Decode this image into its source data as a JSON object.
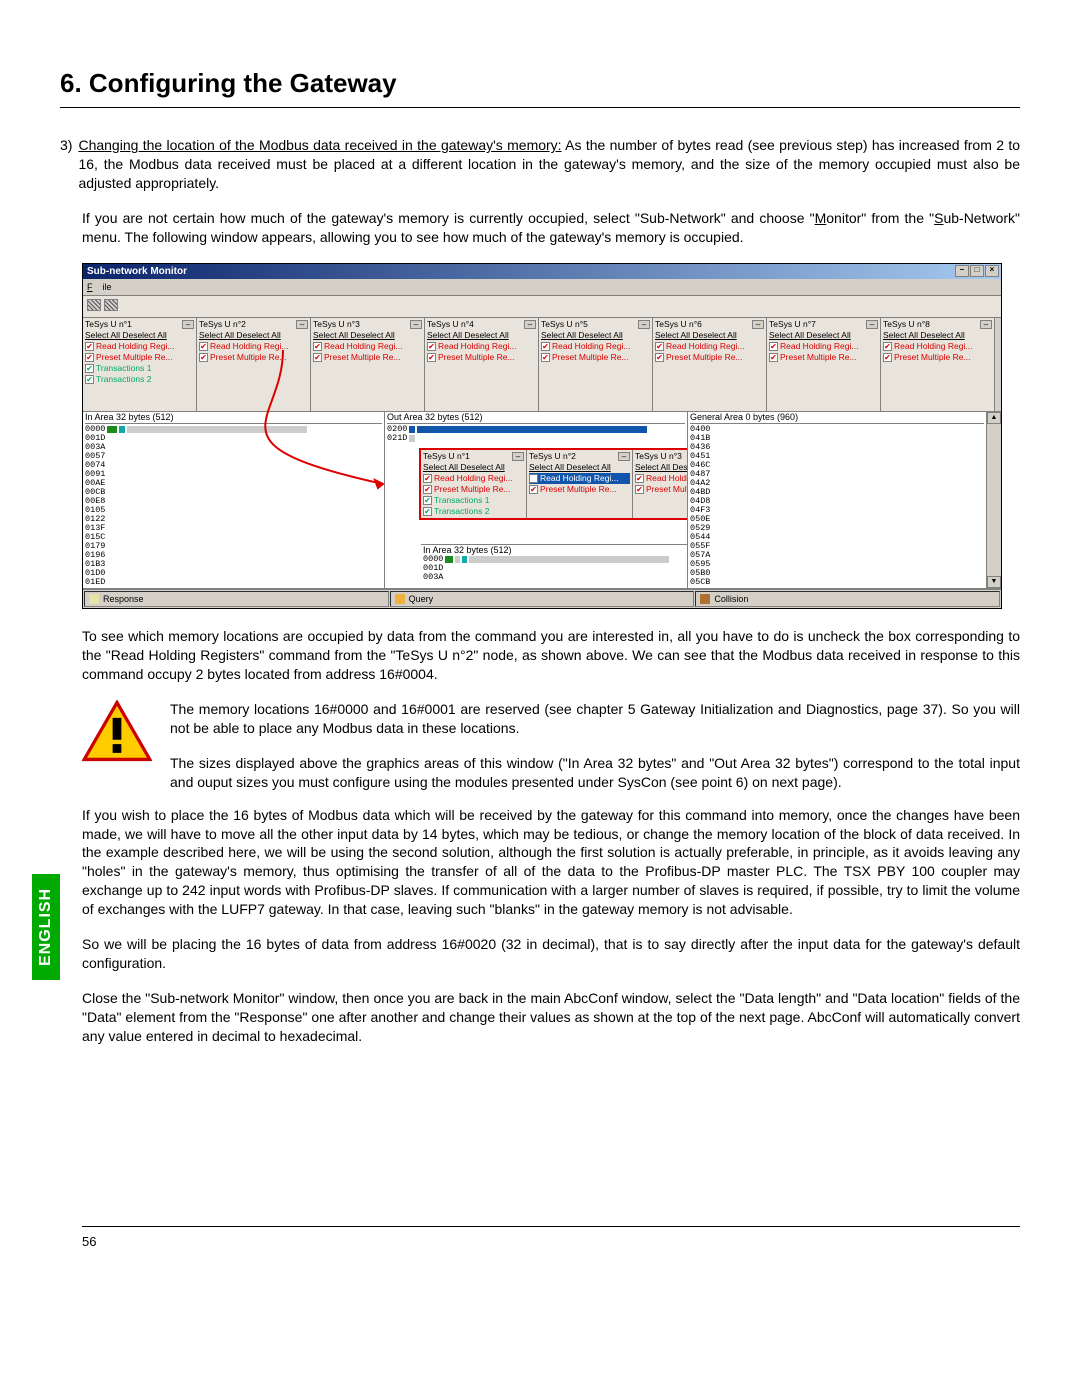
{
  "section_title": "6. Configuring the Gateway",
  "english_badge": "ENGLISH",
  "page_number": "56",
  "item3": {
    "num": "3)",
    "lead_underline": "Changing the location of the Modbus data received in the gateway's memory:",
    "lead_rest": " As the number of bytes read (see previous step) has increased from 2 to 16, the Modbus data received must be placed at a different location in the gateway's memory, and the size of the memory occupied must also be adjusted appropriately."
  },
  "para_if": {
    "p1": "If you are not certain how much of the gateway's memory is currently occupied, select \"Sub-Network\" and choose \"",
    "m": "M",
    "p2": "onitor\" from the \"",
    "s": "S",
    "p3": "ub-Network\" menu. The following window appears, allowing you to see how much of the gateway's memory is occupied."
  },
  "win": {
    "title": "Sub-network Monitor",
    "file": "File",
    "nodes": [
      {
        "name": "TeSys U n°1",
        "select": "Select All  Deselect All",
        "rhr": "Read Holding Regi...",
        "pmr": "Preset Multiple Re...",
        "t1": "Transactions 1",
        "t2": "Transactions 2"
      },
      {
        "name": "TeSys U n°2",
        "select": "Select All  Deselect All",
        "rhr": "Read Holding Regi...",
        "pmr": "Preset Multiple Re..."
      },
      {
        "name": "TeSys U n°3",
        "select": "Select All  Deselect All",
        "rhr": "Read Holding Regi...",
        "pmr": "Preset Multiple Re..."
      },
      {
        "name": "TeSys U n°4",
        "select": "Select All  Deselect All",
        "rhr": "Read Holding Regi...",
        "pmr": "Preset Multiple Re..."
      },
      {
        "name": "TeSys U n°5",
        "select": "Select All  Deselect All",
        "rhr": "Read Holding Regi...",
        "pmr": "Preset Multiple Re..."
      },
      {
        "name": "TeSys U n°6",
        "select": "Select All  Deselect All",
        "rhr": "Read Holding Regi...",
        "pmr": "Preset Multiple Re..."
      },
      {
        "name": "TeSys U n°7",
        "select": "Select All  Deselect All",
        "rhr": "Read Holding Regi...",
        "pmr": "Preset Multiple Re..."
      },
      {
        "name": "TeSys U n°8",
        "select": "Select All  Deselect All",
        "rhr": "Read Holding Regi...",
        "pmr": "Preset Multiple Re..."
      }
    ],
    "areas": {
      "in_hdr": "In Area 32 bytes (512)",
      "out_hdr": "Out Area 32 bytes (512)",
      "gen_hdr": "General Area 0 bytes (960)"
    },
    "in_addrs": [
      "0000",
      "001D",
      "003A",
      "0057",
      "0074",
      "0091",
      "00AE",
      "00CB",
      "00E8",
      "0105",
      "0122",
      "013F",
      "015C",
      "0179",
      "0196",
      "01B3",
      "01D0",
      "01ED"
    ],
    "out_addrs": [
      "0200",
      "021D"
    ],
    "gen_addrs": [
      "0400",
      "041B",
      "0436",
      "0451",
      "046C",
      "0487",
      "04A2",
      "04BD",
      "04D8",
      "04F3",
      "050E",
      "0529",
      "0544",
      "055F",
      "057A",
      "0595",
      "05B0",
      "05CB"
    ],
    "overlay": {
      "nodes": [
        {
          "name": "TeSys U n°1",
          "select": "Select All  Deselect All",
          "rhr": "Read Holding Regi...",
          "pmr": "Preset Multiple Re...",
          "t1": "Transactions 1",
          "t2": "Transactions 2"
        },
        {
          "name": "TeSys U n°2",
          "select": "Select All  Deselect All",
          "rhr": "Read Holding Regi...",
          "pmr": "Preset Multiple Re..."
        },
        {
          "name": "TeSys U n°3",
          "select": "Select All  Des",
          "rhr": "Read Holdin",
          "pmr": "Preset Multip"
        }
      ],
      "in_hdr": "In Area 32 bytes (512)",
      "in_addrs": [
        "0000",
        "001D",
        "003A"
      ]
    },
    "status": {
      "response": "Response",
      "query": "Query",
      "collision": "Collision"
    }
  },
  "para_after_win": "To see which memory locations are occupied by data from the command you are interested in, all you have to do is uncheck the box corresponding to the \"Read Holding Registers\" command from the \"TeSys U n°2\" node, as shown above. We can see that the Modbus data received in response to this command occupy 2 bytes located from address 16#0004.",
  "warn": {
    "p1": "The memory locations 16#0000 and 16#0001 are reserved (see chapter 5 Gateway Initialization and Diagnostics, page 37). So you will not be able to place any Modbus data in these locations.",
    "p2": "The sizes displayed above the graphics areas of this window (\"In Area 32 bytes\" and \"Out Area 32 bytes\") correspond to the total input and ouput sizes you must configure using the modules presented under SysCon (see point 6) on next page)."
  },
  "para_wish": "If you wish to place the 16 bytes of Modbus data which will be received by the gateway for this command into memory, once the changes have been made, we will have to move all the other input data by 14 bytes, which may be tedious, or change the memory location of the block of data received. In the example described here, we will be using the second solution, although the first solution is actually preferable, in principle, as it avoids leaving any \"holes\" in the gateway's memory, thus optimising the transfer of all of the data to the Profibus-DP master PLC. The TSX PBY 100 coupler may exchange up to 242 input words with Profibus-DP slaves. If communication with a larger number of slaves is required, if possible, try to limit the volume of exchanges with the LUFP7 gateway. In that case, leaving such \"blanks\" in the gateway memory is not advisable.",
  "para_so": "So we will be placing the 16 bytes of data from address 16#0020 (32 in decimal), that is to say directly after the input data for the gateway's default configuration.",
  "para_close": "Close the \"Sub-network Monitor\" window, then once you are back in the main AbcConf window, select the \"Data length\" and \"Data location\" fields of the \"Data\" element from the \"Response\" one after another and change their values as shown at the top of the next page. AbcConf will automatically convert any value entered in decimal to hexadecimal."
}
